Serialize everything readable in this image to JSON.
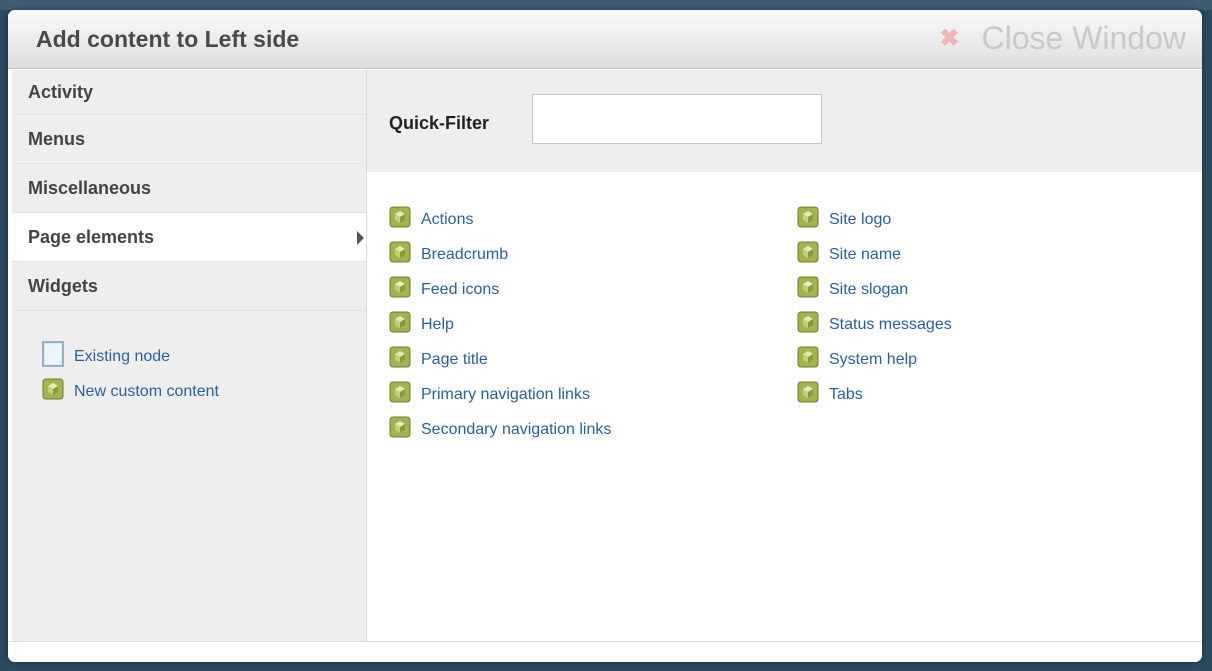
{
  "window": {
    "title": "Add content to Left side",
    "close_label": "Close Window"
  },
  "sidebar": {
    "categories": [
      {
        "label": "Activity"
      },
      {
        "label": "Menus"
      },
      {
        "label": "Miscellaneous"
      },
      {
        "label": "Page elements"
      },
      {
        "label": "Widgets"
      }
    ],
    "active_category": "Page elements",
    "extras": [
      {
        "label": "Existing node",
        "icon": "page-icon"
      },
      {
        "label": "New custom content",
        "icon": "block-cube-icon"
      }
    ]
  },
  "filter": {
    "label": "Quick-Filter",
    "value": ""
  },
  "content": {
    "column1": [
      {
        "label": "Actions"
      },
      {
        "label": "Breadcrumb"
      },
      {
        "label": "Feed icons"
      },
      {
        "label": "Help"
      },
      {
        "label": "Page title"
      },
      {
        "label": "Primary navigation links"
      },
      {
        "label": "Secondary navigation links"
      }
    ],
    "column2": [
      {
        "label": "Site logo"
      },
      {
        "label": "Site name"
      },
      {
        "label": "Site slogan"
      },
      {
        "label": "Status messages"
      },
      {
        "label": "System help"
      },
      {
        "label": "Tabs"
      }
    ],
    "item_icon": "block-cube-icon"
  },
  "colors": {
    "link": "#2a5f9e",
    "icon_green": "#a2b350",
    "panel_gray": "#eeeeee"
  }
}
